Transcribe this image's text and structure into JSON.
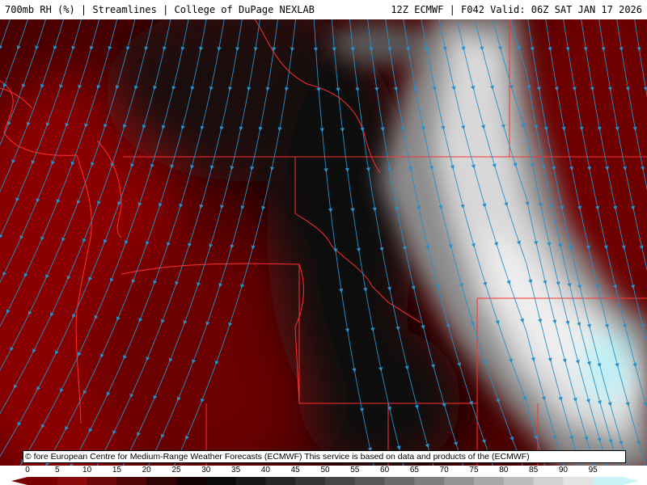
{
  "header": {
    "left": "700mb RH (%) | Streamlines | College of DuPage NEXLAB",
    "right": "12Z ECMWF | F042 Valid: 06Z SAT JAN 17 2026"
  },
  "credit": "© fore European Centre for Medium-Range Weather Forecasts (ECMWF)  This service is based on data and products of the (ECMWF)",
  "legend": {
    "ticks": [
      "0",
      "5",
      "10",
      "15",
      "20",
      "25",
      "30",
      "35",
      "40",
      "45",
      "50",
      "55",
      "60",
      "65",
      "70",
      "75",
      "80",
      "85",
      "90",
      "95"
    ],
    "colors": [
      "#7a0000",
      "#8a0a0a",
      "#6a0808",
      "#4e0606",
      "#300404",
      "#140202",
      "#0a0a0a",
      "#181818",
      "#262626",
      "#363636",
      "#464646",
      "#585858",
      "#6a6a6a",
      "#7e7e7e",
      "#939393",
      "#a8a8a8",
      "#bdbdbd",
      "#d2d2d2",
      "#e4e4e4",
      "#c8f4f8"
    ]
  },
  "map": {
    "streamline_color": "#2a8fc8",
    "boundary_color": "#ff3030"
  }
}
